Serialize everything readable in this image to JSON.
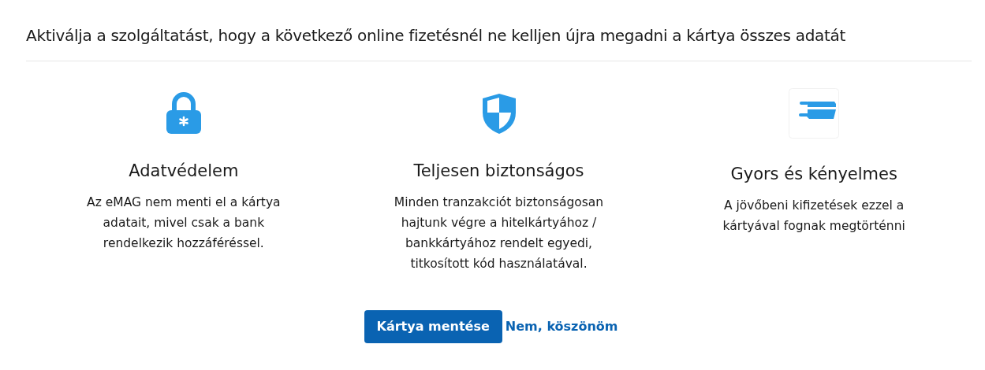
{
  "heading": "Aktiválja a szolgáltatást, hogy a következő online fizetésnél ne kelljen újra megadni a kártya összes adatát",
  "features": [
    {
      "kind": "lock",
      "title": "Adatvédelem",
      "text": "Az eMAG nem menti el a kártya adatait, mivel csak a bank rendelkezik hozzáféréssel."
    },
    {
      "kind": "shield",
      "title": "Teljesen biztonságos",
      "text": "Minden tranzakciót biztonságosan hajtunk végre a hitelkártyához / bankkártyához rendelt egyedi, titkosított kód használatával."
    },
    {
      "kind": "card",
      "title": "Gyors és kényelmes",
      "text": "A jövőbeni kifizetések ezzel a kártyával fognak megtörténni"
    }
  ],
  "buttons": {
    "primary": "Kártya mentése",
    "link": "Nem, köszönöm"
  }
}
